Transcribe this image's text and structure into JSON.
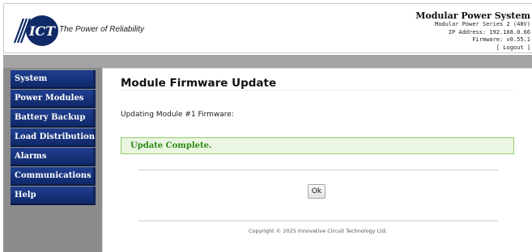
{
  "header": {
    "tagline": "The Power of Reliability",
    "logo_text": "ICT",
    "system_title": "Modular Power System",
    "system_model": "Modular Power Series 2 (48V)",
    "ip_address": "IP Address: 192.168.0.66",
    "firmware": "Firmware: v0.55.1",
    "logout_label": "[ Logout ]"
  },
  "sidebar": {
    "items": [
      {
        "label": "System"
      },
      {
        "label": "Power Modules"
      },
      {
        "label": "Battery Backup"
      },
      {
        "label": "Load Distribution"
      },
      {
        "label": "Alarms"
      },
      {
        "label": "Communications"
      },
      {
        "label": "Help"
      }
    ]
  },
  "main": {
    "title": "Module Firmware Update",
    "status_text": "Updating Module #1 Firmware:",
    "result_text": "Update Complete.",
    "ok_label": "Ok",
    "copyright": "Copyright © 2025 Innovative Circuit Technology Ltd."
  },
  "colors": {
    "nav_bg": "#1f3f90",
    "success_bg": "#eaf6e2",
    "success_border": "#8fce66",
    "success_text": "#2a8a12"
  }
}
